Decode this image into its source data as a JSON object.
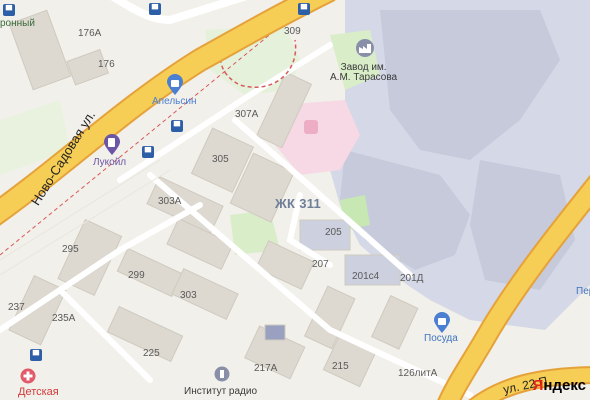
{
  "map": {
    "streets": {
      "main": "Ново-Садовая ул.",
      "bottom_right": "ул. 22 П"
    },
    "complex_label": "ЖК 311",
    "pois": {
      "factory": "Завод им.\nА.М. Тарасова",
      "orange": "Апельсин",
      "lukoil": "Лукойл",
      "dishes": "Посуда",
      "institute": "Институт радио",
      "kids": "Детская",
      "partial_right": "Пер",
      "partial_top_left": "ронный"
    },
    "house_numbers": {
      "h309": "309",
      "h176a": "176А",
      "h176": "176",
      "h307a": "307А",
      "h305": "305",
      "h303a": "303А",
      "h205": "205",
      "h295": "295",
      "h207": "207",
      "h201c4": "201с4",
      "h201d": "201Д",
      "h299": "299",
      "h303": "303",
      "h237": "237",
      "h235a": "235А",
      "h225": "225",
      "h217a": "217А",
      "h215": "215",
      "h126lit": "126литА"
    },
    "logo": {
      "brand_red": "Я",
      "brand_rest": "ндекс"
    },
    "colors": {
      "main_road": "#f5c84a",
      "road_edge": "#e6a23a",
      "industrial": "#d3d6e4",
      "hospital": "#f6d9e4",
      "green": "#d4ebc5",
      "bus_stop": "#2d5ea8",
      "poi_purple": "#6a55a6"
    },
    "icons": [
      "bus-stop-icon",
      "shopping-bag-icon",
      "fuel-icon",
      "factory-icon",
      "hospital-icon",
      "institute-icon",
      "kids-cross-icon"
    ]
  }
}
